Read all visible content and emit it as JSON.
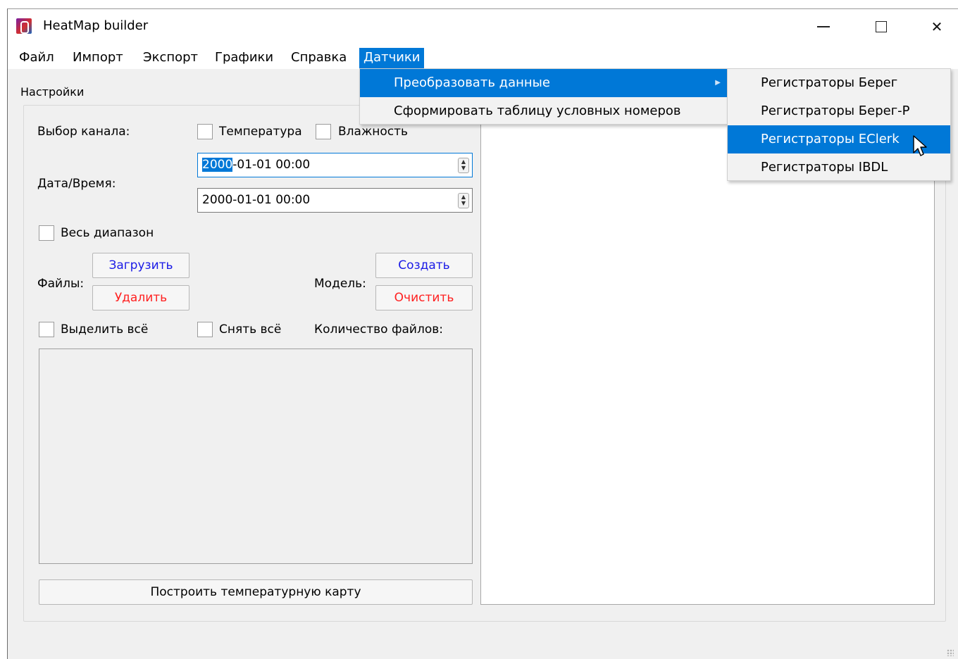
{
  "window": {
    "title": "HeatMap builder"
  },
  "menubar": {
    "items": [
      {
        "label": "Файл"
      },
      {
        "label": "Импорт"
      },
      {
        "label": "Экспорт"
      },
      {
        "label": "Графики"
      },
      {
        "label": "Справка"
      },
      {
        "label": "Датчики",
        "active": true
      }
    ]
  },
  "sensors_menu": {
    "items": [
      {
        "label": "Преобразовать данные",
        "has_submenu": true,
        "active": true
      },
      {
        "label": "Сформировать таблицу условных номеров"
      }
    ]
  },
  "convert_submenu": {
    "items": [
      {
        "label": "Регистраторы Берег"
      },
      {
        "label": "Регистраторы Берег-Р"
      },
      {
        "label": "Регистраторы EClerk",
        "active": true
      },
      {
        "label": "Регистраторы IBDL"
      }
    ]
  },
  "settings": {
    "title": "Настройки",
    "channel_label": "Выбор канала:",
    "temperature_label": "Температура",
    "humidity_label": "Влажность",
    "datetime_label": "Дата/Время:",
    "date_from": {
      "selected": "2000",
      "rest": "-01-01 00:00"
    },
    "date_to": "2000-01-01 00:00",
    "full_range_label": "Весь диапазон",
    "files_label": "Файлы:",
    "load_button": "Загрузить",
    "delete_button": "Удалить",
    "model_label": "Модель:",
    "create_button": "Создать",
    "clear_button": "Очистить",
    "select_all_label": "Выделить всё",
    "deselect_all_label": "Снять всё",
    "file_count_label": "Количество файлов:",
    "build_button": "Построить температурную карту"
  },
  "colors": {
    "accent": "#0078d7",
    "blue_button_text": "#1a1ae6",
    "red_button_text": "#ff2020"
  }
}
